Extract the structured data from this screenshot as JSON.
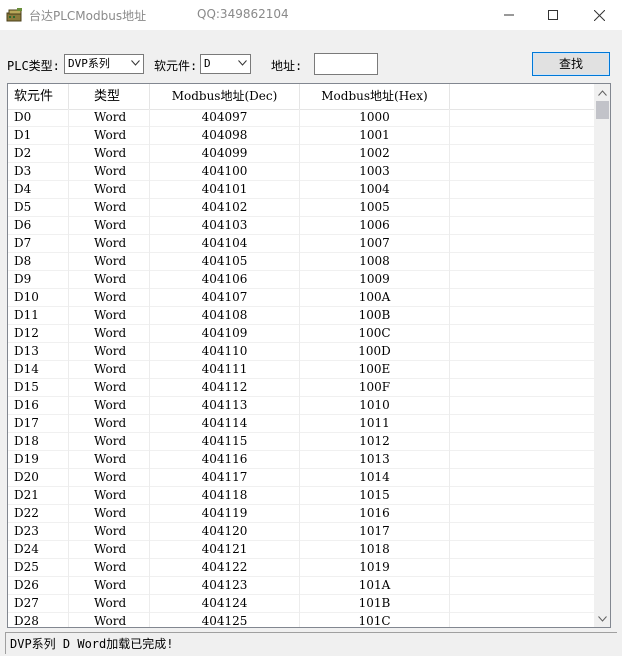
{
  "window": {
    "title": "台达PLCModbus地址",
    "qq": "QQ:349862104",
    "icon": "plc-app-icon"
  },
  "toolbar": {
    "plc_type_label": "PLC类型:",
    "plc_type_value": "DVP系列",
    "device_label": "软元件:",
    "device_value": "D",
    "address_label": "地址:",
    "address_value": "",
    "find_label": "查找"
  },
  "grid": {
    "headers": [
      "软元件",
      "类型",
      "Modbus地址(Dec)",
      "Modbus地址(Hex)"
    ],
    "rows": [
      [
        "D0",
        "Word",
        "404097",
        "1000"
      ],
      [
        "D1",
        "Word",
        "404098",
        "1001"
      ],
      [
        "D2",
        "Word",
        "404099",
        "1002"
      ],
      [
        "D3",
        "Word",
        "404100",
        "1003"
      ],
      [
        "D4",
        "Word",
        "404101",
        "1004"
      ],
      [
        "D5",
        "Word",
        "404102",
        "1005"
      ],
      [
        "D6",
        "Word",
        "404103",
        "1006"
      ],
      [
        "D7",
        "Word",
        "404104",
        "1007"
      ],
      [
        "D8",
        "Word",
        "404105",
        "1008"
      ],
      [
        "D9",
        "Word",
        "404106",
        "1009"
      ],
      [
        "D10",
        "Word",
        "404107",
        "100A"
      ],
      [
        "D11",
        "Word",
        "404108",
        "100B"
      ],
      [
        "D12",
        "Word",
        "404109",
        "100C"
      ],
      [
        "D13",
        "Word",
        "404110",
        "100D"
      ],
      [
        "D14",
        "Word",
        "404111",
        "100E"
      ],
      [
        "D15",
        "Word",
        "404112",
        "100F"
      ],
      [
        "D16",
        "Word",
        "404113",
        "1010"
      ],
      [
        "D17",
        "Word",
        "404114",
        "1011"
      ],
      [
        "D18",
        "Word",
        "404115",
        "1012"
      ],
      [
        "D19",
        "Word",
        "404116",
        "1013"
      ],
      [
        "D20",
        "Word",
        "404117",
        "1014"
      ],
      [
        "D21",
        "Word",
        "404118",
        "1015"
      ],
      [
        "D22",
        "Word",
        "404119",
        "1016"
      ],
      [
        "D23",
        "Word",
        "404120",
        "1017"
      ],
      [
        "D24",
        "Word",
        "404121",
        "1018"
      ],
      [
        "D25",
        "Word",
        "404122",
        "1019"
      ],
      [
        "D26",
        "Word",
        "404123",
        "101A"
      ],
      [
        "D27",
        "Word",
        "404124",
        "101B"
      ],
      [
        "D28",
        "Word",
        "404125",
        "101C"
      ]
    ]
  },
  "status": {
    "text": "DVP系列 D Word加载已完成!"
  },
  "colors": {
    "focus_border": "#0078d7",
    "window_bg": "#f0f0f0"
  }
}
